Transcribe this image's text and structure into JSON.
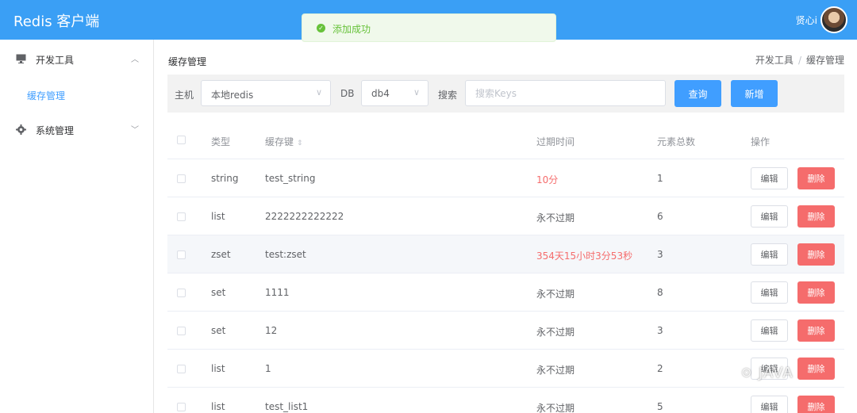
{
  "app": {
    "title": "Redis 客户端"
  },
  "user": {
    "name": "贤心i"
  },
  "toast": {
    "message": "添加成功"
  },
  "sidebar": {
    "items": [
      {
        "label": "开发工具",
        "icon": "monitor-icon",
        "expanded": true
      },
      {
        "label": "系统管理",
        "icon": "gear-icon",
        "expanded": false
      }
    ],
    "sub_items": [
      {
        "label": "缓存管理",
        "active": true
      }
    ]
  },
  "page": {
    "title": "缓存管理",
    "breadcrumb": [
      "开发工具",
      "缓存管理"
    ]
  },
  "filters": {
    "host_label": "主机",
    "host_value": "本地redis",
    "db_label": "DB",
    "db_value": "db4",
    "search_label": "搜索",
    "search_placeholder": "搜索Keys",
    "query_button": "查询",
    "add_button": "新增"
  },
  "table": {
    "columns": {
      "type": "类型",
      "key": "缓存键",
      "expire": "过期时间",
      "count": "元素总数",
      "ops": "操作"
    },
    "edit_label": "编辑",
    "delete_label": "删除",
    "rows": [
      {
        "type": "string",
        "key": "test_string",
        "expire": "10分",
        "expire_highlight": true,
        "count": "1"
      },
      {
        "type": "list",
        "key": "2222222222222",
        "expire": "永不过期",
        "expire_highlight": false,
        "count": "6"
      },
      {
        "type": "zset",
        "key": "test:zset",
        "expire": "354天15小时3分53秒",
        "expire_highlight": true,
        "count": "3"
      },
      {
        "type": "set",
        "key": "1111",
        "expire": "永不过期",
        "expire_highlight": false,
        "count": "8"
      },
      {
        "type": "set",
        "key": "12",
        "expire": "永不过期",
        "expire_highlight": false,
        "count": "3"
      },
      {
        "type": "list",
        "key": "1",
        "expire": "永不过期",
        "expire_highlight": false,
        "count": "2"
      },
      {
        "type": "list",
        "key": "test_list1",
        "expire": "永不过期",
        "expire_highlight": false,
        "count": "5"
      }
    ]
  },
  "watermark": {
    "text": "JAVA"
  },
  "colors": {
    "header": "#3a9ff5",
    "primary": "#409eff",
    "danger": "#f56c6c",
    "success": "#67c23a"
  }
}
